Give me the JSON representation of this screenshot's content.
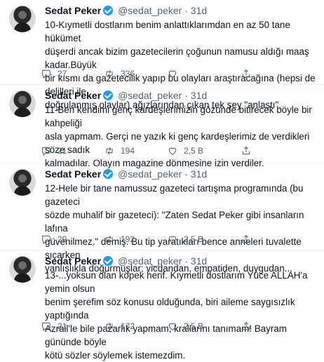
{
  "tweets": [
    {
      "name": "Sedat Peker",
      "handle": "@sedat_peker",
      "time": "· 31d",
      "text": "10-Kıymetli dostlarım benim anlattıklarımdan en az 50 tane hükümet\ndüşerdi ancak bizim gazetecilerin çoğunun namusu aldığı maaş kadar.Büyük\nbir kısmı da gazetecilik yapıp bu olayları araştıracağına (hepsi de delilleri ile\ndoğrulanmış olaylar) ağızlarından çıkan tek şey \"anlaştı\".",
      "replies": "27",
      "retweets": "336",
      "likes": ""
    },
    {
      "name": "Sedat Peker",
      "handle": "@sedat_peker",
      "time": "· 31d",
      "text": "11-Ben kendimi genç kardeşlerimizin gözünde bitirecek böyle bir kahpeliği\nasla yapmam. Gerçi ne yazık ki genç kardeşlerimiz de verdikleri söze sadık\nkalmadılar. Olayın magazine dönmesine izin verdiler.",
      "replies": "21",
      "retweets": "194",
      "likes": "2,5 B"
    },
    {
      "name": "Sedat Peker",
      "handle": "@sedat_peker",
      "time": "· 31d",
      "text": "12-Hele bir tane namussuz gazeteci tartışma programında (bu gazeteci\nsözde muhalif bir gazeteci): \"Zaten Sedat Peker gibi insanların lafına\ngüvenilmez.\" demiş. Bu tip yaratıkları bence anneleri tuvalette sıçarken\nyanlışlıkla doğurmuşlar; vicdandan, empatiden, duygudan...",
      "replies": "29",
      "retweets": "192",
      "likes": "2,5 B"
    },
    {
      "name": "Sedat Peker",
      "handle": "@sedat_peker",
      "time": "· 31d",
      "text": "13-...yoksun olan köpek herif. Kıymetli dostlarım Yüce ALLAH'a yemin olsun\nbenim şerefim söz konusu olduğunda, biri aileme saygısızlık yaptığında\nAzrail'le bile pazarlık yapmam, krallarını tanımam! Bayram gününde böyle\nkötü sözler söylemek istemezdim.",
      "replies": "21",
      "retweets": "172",
      "likes": "2,5 B"
    }
  ],
  "icons": {
    "reply": "reply-icon",
    "retweet": "retweet-icon",
    "like": "like-icon",
    "share": "share-icon",
    "verified": "verified-badge-icon"
  },
  "colors": {
    "verified": "#1d9bf0",
    "meta": "#536471",
    "divider": "#e6ecf0"
  }
}
